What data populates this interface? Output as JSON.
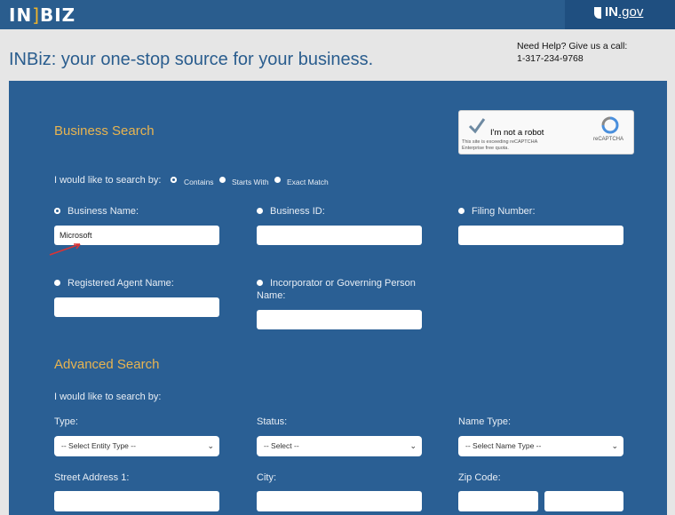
{
  "brand": {
    "logo": "IN|BIZ",
    "logo_left": "IN",
    "logo_right": "BIZ",
    "gov": "IN",
    "gov_suffix": ".gov"
  },
  "header": {
    "tagline": "INBiz: your one-stop source for your business.",
    "help_line1": "Need Help? Give us a call:",
    "help_line2": "1-317-234-9768"
  },
  "business_search": {
    "title": "Business Search",
    "search_by": "I would like to search by:",
    "match_options": [
      "Contains",
      "Starts With",
      "Exact Match"
    ],
    "selected_match": "Contains",
    "fields": [
      {
        "label": "Business Name:",
        "value": "Microsoft",
        "selected": true
      },
      {
        "label": "Business ID:",
        "value": ""
      },
      {
        "label": "Filing Number:",
        "value": ""
      },
      {
        "label": "Registered Agent Name:",
        "value": ""
      },
      {
        "label_line1": "Incorporator or Governing Person",
        "label_line2": "Name:",
        "value": ""
      }
    ]
  },
  "captcha": {
    "label": "I'm not a robot",
    "brand": "reCAPTCHA",
    "note_line1": "This site is exceeding reCAPTCHA",
    "note_line2": "Enterprise free quota."
  },
  "advanced_search": {
    "title": "Advanced Search",
    "search_by": "I would like to search by:",
    "type_label": "Type:",
    "type_value": "-- Select Entity Type --",
    "status_label": "Status:",
    "status_value": "-- Select --",
    "name_type_label": "Name Type:",
    "name_type_value": "-- Select Name Type --",
    "street_label": "Street Address 1:",
    "city_label": "City:",
    "zip_label": "Zip Code:"
  }
}
